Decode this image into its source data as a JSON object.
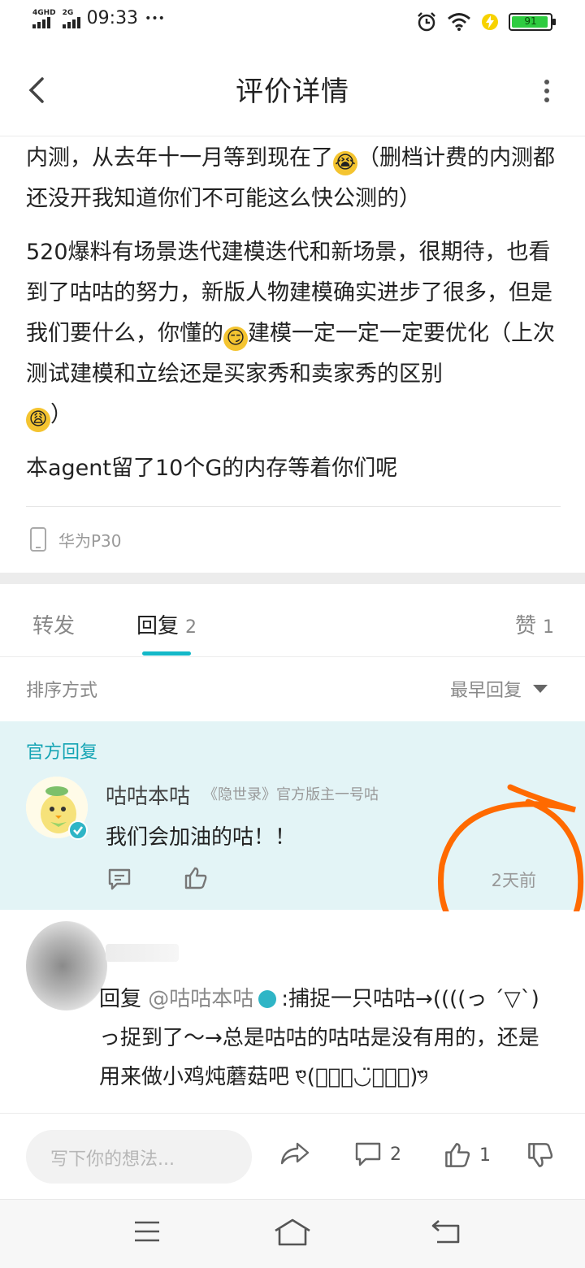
{
  "status_bar": {
    "network1": "4GHD",
    "network2": "2G",
    "time": "09:33",
    "dots": "•••",
    "battery": "91"
  },
  "header": {
    "title": "评价详情"
  },
  "review": {
    "paragraphs": [
      [
        "内测，从去年十一月等到现在了",
        "（删档计费的内测都还没开我知道你们不可能这么快公测的）"
      ],
      [
        "520爆料有场景迭代建模迭代和新场景，很期待，也看到了咕咕的努力，新版人物建模确实进步了很多，但是我们要什么，你懂的",
        "建模一定一定一定要优化（上次测试建模和立绘还是买家秀和卖家秀的区别",
        "）"
      ],
      [
        "本agent留了10个G的内存等着你们呢"
      ]
    ],
    "device": "华为P30"
  },
  "tabs": {
    "forward": "转发",
    "reply": "回复",
    "reply_count": "2",
    "like": "赞",
    "like_count": "1"
  },
  "sort": {
    "label": "排序方式",
    "value": "最早回复"
  },
  "official_reply": {
    "section_label": "官方回复",
    "username": "咕咕本咕",
    "subtitle": "《隐世录》官方版主一号咕",
    "text": "我们会加油的咕！！",
    "time": "2天前"
  },
  "user_reply": {
    "prefix": "回复",
    "mention": "@咕咕本咕",
    "text": ":捕捉一只咕咕→((((っ ˊ▽ˋ)っ捉到了～→总是咕咕的咕咕是没有用的，还是用来做小鸡炖蘑菇吧 ୧⃛(๑⃙⃘◡̈︎๑⃙⃘)୨⃛"
  },
  "bottom_bar": {
    "placeholder": "写下你的想法...",
    "comment_count": "2",
    "like_count": "1"
  },
  "colors": {
    "accent": "#14b8c8",
    "official_bg": "#e3f4f6",
    "annotation": "#ff6a00"
  }
}
